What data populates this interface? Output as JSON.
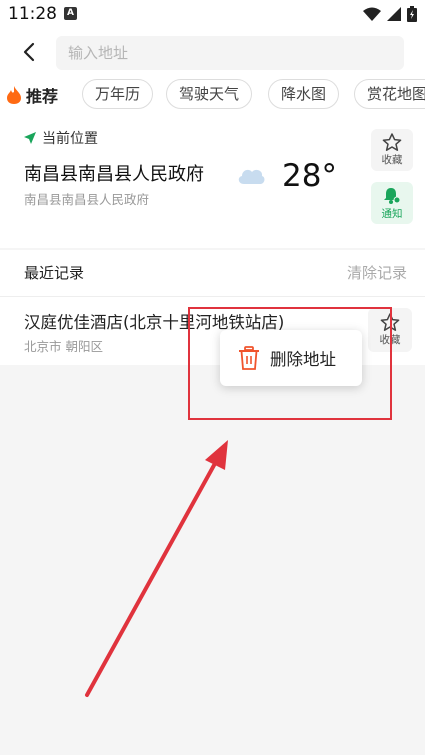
{
  "status_bar": {
    "time": "11:28",
    "notif_icon_letter": "A",
    "icons": [
      "wifi-icon",
      "signal-icon",
      "battery-icon"
    ]
  },
  "search": {
    "placeholder": "输入地址",
    "value": ""
  },
  "tags": {
    "recommend_label": "推荐",
    "items": [
      "万年历",
      "驾驶天气",
      "降水图",
      "赏花地图"
    ]
  },
  "current_location": {
    "label": "当前位置",
    "name": "南昌县南昌县人民政府",
    "sub": "南昌县南昌县人民政府",
    "weather_icon": "cloud-icon",
    "temperature": "28°",
    "favorite_label": "收藏",
    "notify_label": "通知"
  },
  "recent": {
    "title": "最近记录",
    "clear_label": "清除记录",
    "items": [
      {
        "name": "汉庭优佳酒店(北京十里河地铁站店)",
        "sub": "北京市 朝阳区",
        "favorite_label": "收藏"
      }
    ]
  },
  "context_menu": {
    "delete_label": "删除地址",
    "delete_icon": "trash-icon"
  },
  "colors": {
    "accent_green": "#1aa55b",
    "annotation_red": "#e0333d",
    "delete_orange": "#f0542d",
    "fire_orange": "#ff6a13"
  }
}
